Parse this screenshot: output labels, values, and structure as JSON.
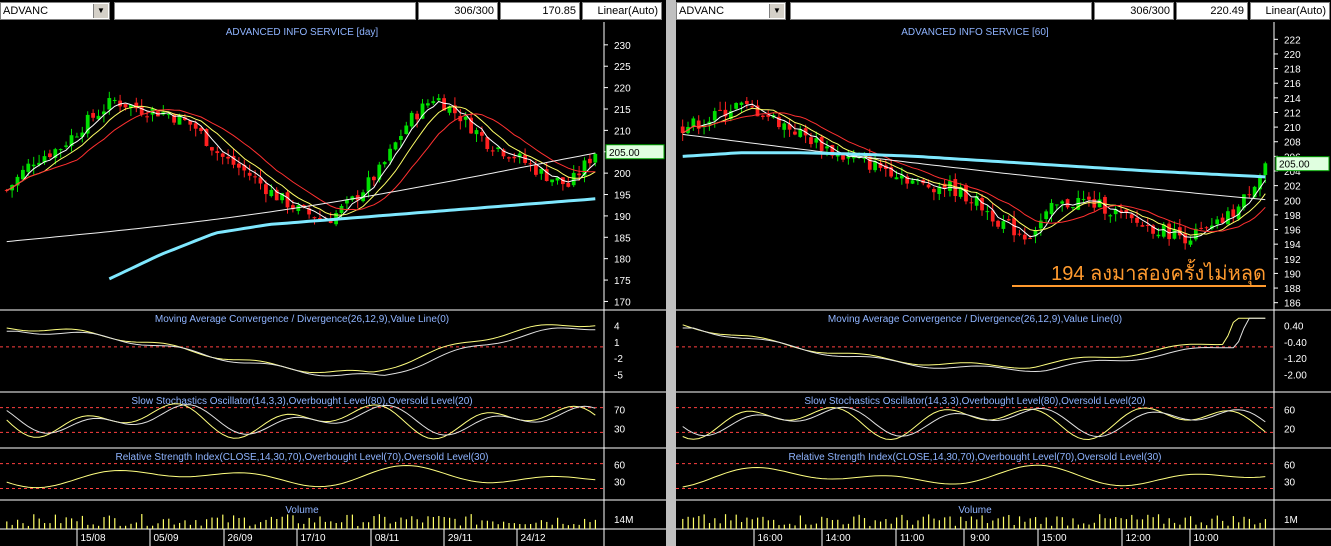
{
  "left": {
    "symbol": "ADVANC",
    "count": "306/300",
    "price": "170.85",
    "scale": "Linear(Auto)",
    "title": "ADVANCED INFO SERVICE [day]",
    "last_price_label": "205.00",
    "price_ticks": [
      "230",
      "225",
      "220",
      "215",
      "210",
      "205",
      "200",
      "195",
      "190",
      "185",
      "180",
      "175",
      "170"
    ],
    "macd_label": "Moving Average Convergence / Divergence(26,12,9),Value Line(0)",
    "macd_ticks": [
      "4",
      "1",
      "-2",
      "-5"
    ],
    "stoch_label": "Slow Stochastics Oscillator(14,3,3),Overbought Level(80),Oversold Level(20)",
    "stoch_ticks": [
      "70",
      "30"
    ],
    "rsi_label": "Relative Strength Index(CLOSE,14,30,70),Overbought Level(70),Oversold Level(30)",
    "rsi_ticks": [
      "60",
      "30"
    ],
    "volume_label": "Volume",
    "volume_tick": "14M",
    "dates": [
      "15/08",
      "05/09",
      "26/09",
      "17/10",
      "08/11",
      "29/11",
      "24/12"
    ]
  },
  "right": {
    "symbol": "ADVANC",
    "count": "306/300",
    "price": "220.49",
    "scale": "Linear(Auto)",
    "title": "ADVANCED INFO SERVICE [60]",
    "last_price_label": "205.00",
    "price_ticks": [
      "222",
      "220",
      "218",
      "216",
      "214",
      "212",
      "210",
      "208",
      "206",
      "204",
      "202",
      "200",
      "198",
      "196",
      "194",
      "192",
      "190",
      "188",
      "186"
    ],
    "annotation": "194 ลงมาสองครั้งไม่หลุด",
    "macd_label": "Moving Average Convergence / Divergence(26,12,9),Value Line(0)",
    "macd_ticks": [
      "0.40",
      "-0.40",
      "-1.20",
      "-2.00"
    ],
    "stoch_label": "Slow Stochastics Oscillator(14,3,3),Overbought Level(80),Oversold Level(20)",
    "stoch_ticks": [
      "60",
      "20"
    ],
    "rsi_label": "Relative Strength Index(CLOSE,14,30,70),Overbought Level(70),Oversold Level(30)",
    "rsi_ticks": [
      "60",
      "30"
    ],
    "volume_label": "Volume",
    "volume_tick": "1M",
    "times": [
      "16:00",
      "14:00",
      "11:00",
      "9:00",
      "15:00",
      "12:00",
      "10:00"
    ]
  },
  "chart_data": [
    {
      "type": "candlestick",
      "title": "ADVANCED INFO SERVICE [day]",
      "ylim": [
        168,
        233
      ],
      "x_labels": [
        "15/08",
        "05/09",
        "26/09",
        "17/10",
        "08/11",
        "29/11",
        "24/12"
      ],
      "approx_close": [
        196,
        203,
        206,
        212,
        217,
        215,
        214,
        211,
        204,
        200,
        195,
        191,
        189,
        194,
        201,
        212,
        218,
        213,
        207,
        204,
        200,
        197,
        205
      ],
      "last": 205.0,
      "long_ma": [
        175,
        181,
        186,
        188,
        189,
        190,
        191,
        192,
        193,
        194
      ],
      "overlay_mas": [
        "short MA",
        "medium MA",
        "long MA"
      ],
      "indicators": [
        "MACD(26,12,9)",
        "Slow Stochastics(14,3,3)",
        "RSI(14)",
        "Volume"
      ]
    },
    {
      "type": "candlestick",
      "title": "ADVANCED INFO SERVICE [60]",
      "ylim": [
        185,
        223
      ],
      "x_labels": [
        "16:00",
        "14:00",
        "11:00",
        "9:00",
        "15:00",
        "12:00",
        "10:00"
      ],
      "approx_close": [
        210,
        211,
        213,
        212,
        210,
        208,
        206,
        205,
        204,
        202,
        202,
        200,
        197,
        195,
        199,
        200,
        199,
        197,
        196,
        195,
        196,
        199,
        205
      ],
      "last": 205.0,
      "long_ma": [
        206,
        206.5,
        206.5,
        206.3,
        206,
        205.5,
        205,
        204.5,
        204,
        203.6,
        203.2
      ],
      "annotation": "194 ลงมาสองครั้งไม่หลุด",
      "indicators": [
        "MACD(26,12,9)",
        "Slow Stochastics(14,3,3)",
        "RSI(14)",
        "Volume"
      ]
    }
  ]
}
